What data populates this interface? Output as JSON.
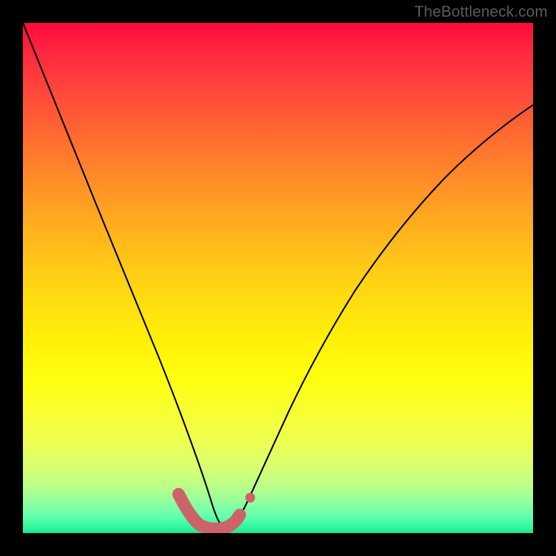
{
  "watermark": "TheBottleneck.com",
  "chart_data": {
    "type": "line",
    "title": "",
    "xlabel": "",
    "ylabel": "",
    "xlim": [
      0,
      1
    ],
    "ylim": [
      0,
      1
    ],
    "series": [
      {
        "name": "bottleneck-curve",
        "x": [
          0.0,
          0.03,
          0.06,
          0.09,
          0.12,
          0.15,
          0.18,
          0.21,
          0.24,
          0.27,
          0.295,
          0.315,
          0.33,
          0.345,
          0.36,
          0.38,
          0.4,
          0.42,
          0.44,
          0.47,
          0.5,
          0.54,
          0.58,
          0.63,
          0.68,
          0.74,
          0.8,
          0.87,
          0.94,
          1.0
        ],
        "y": [
          1.0,
          0.88,
          0.77,
          0.66,
          0.56,
          0.47,
          0.38,
          0.29,
          0.21,
          0.14,
          0.09,
          0.055,
          0.035,
          0.02,
          0.012,
          0.01,
          0.015,
          0.03,
          0.055,
          0.11,
          0.17,
          0.25,
          0.325,
          0.41,
          0.485,
          0.565,
          0.635,
          0.7,
          0.755,
          0.795
        ]
      }
    ],
    "optimal_range": {
      "x_start": 0.305,
      "x_end": 0.415
    },
    "colors": {
      "top": "#ff0a3a",
      "mid": "#ffff10",
      "bottom": "#15e88e",
      "curve": "#000000",
      "optimal": "#cb6368",
      "frame": "#000000"
    }
  }
}
